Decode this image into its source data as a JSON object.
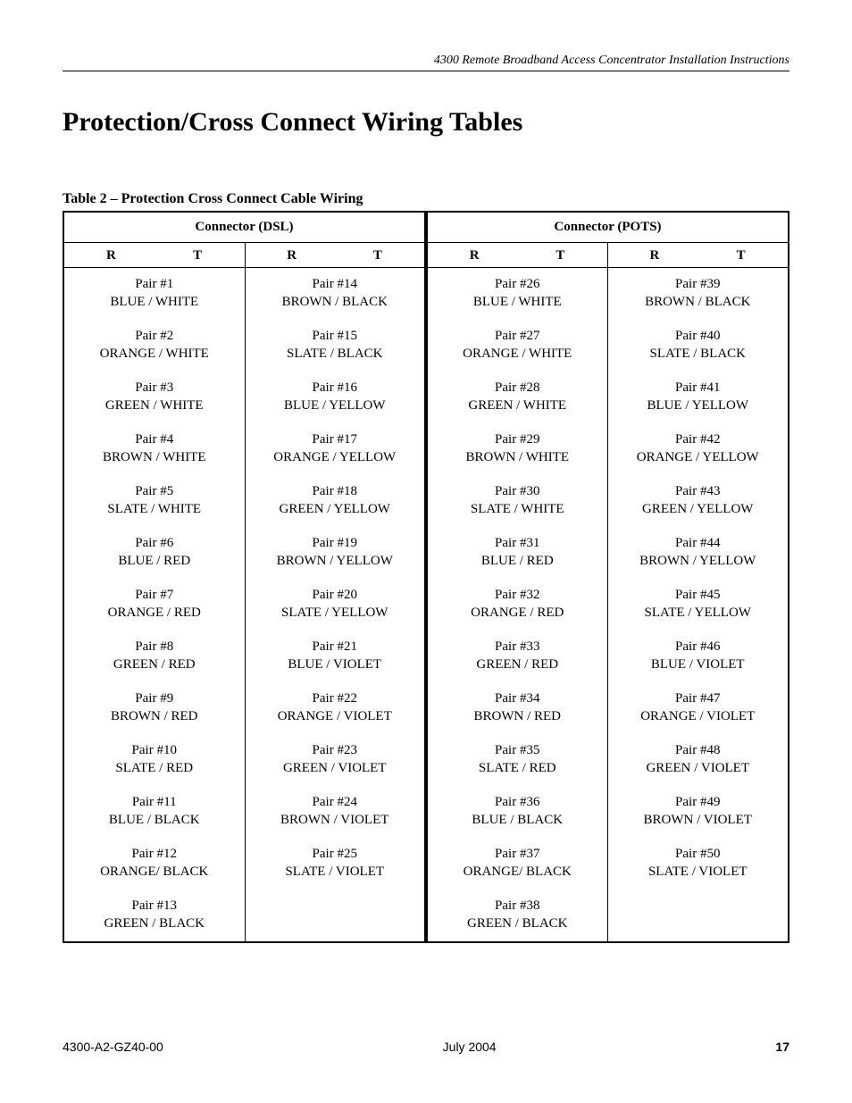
{
  "header": {
    "running": "4300 Remote Broadband Access Concentrator  Installation Instructions"
  },
  "title": "Protection/Cross Connect Wiring Tables",
  "caption": {
    "lead": "Table 2",
    "dash": "–",
    "rest": "Protection Cross Connect Cable Wiring"
  },
  "thead": {
    "dsl": "Connector (DSL)",
    "pots": "Connector (POTS)",
    "r": "R",
    "t": "T"
  },
  "rows": [
    {
      "c1p": "Pair #1",
      "c1c": "BLUE / WHITE",
      "c2p": "Pair #14",
      "c2c": "BROWN / BLACK",
      "c3p": "Pair #26",
      "c3c": "BLUE / WHITE",
      "c4p": "Pair #39",
      "c4c": "BROWN / BLACK"
    },
    {
      "c1p": "Pair #2",
      "c1c": "ORANGE / WHITE",
      "c2p": "Pair #15",
      "c2c": "SLATE / BLACK",
      "c3p": "Pair #27",
      "c3c": "ORANGE / WHITE",
      "c4p": "Pair #40",
      "c4c": "SLATE / BLACK"
    },
    {
      "c1p": "Pair #3",
      "c1c": "GREEN / WHITE",
      "c2p": "Pair #16",
      "c2c": "BLUE / YELLOW",
      "c3p": "Pair #28",
      "c3c": "GREEN / WHITE",
      "c4p": "Pair #41",
      "c4c": "BLUE / YELLOW"
    },
    {
      "c1p": "Pair #4",
      "c1c": "BROWN / WHITE",
      "c2p": "Pair #17",
      "c2c": "ORANGE / YELLOW",
      "c3p": "Pair #29",
      "c3c": "BROWN / WHITE",
      "c4p": "Pair #42",
      "c4c": "ORANGE / YELLOW"
    },
    {
      "c1p": "Pair #5",
      "c1c": "SLATE / WHITE",
      "c2p": "Pair #18",
      "c2c": "GREEN / YELLOW",
      "c3p": "Pair #30",
      "c3c": "SLATE / WHITE",
      "c4p": "Pair #43",
      "c4c": "GREEN / YELLOW"
    },
    {
      "c1p": "Pair #6",
      "c1c": "BLUE / RED",
      "c2p": "Pair #19",
      "c2c": "BROWN / YELLOW",
      "c3p": "Pair #31",
      "c3c": "BLUE / RED",
      "c4p": "Pair #44",
      "c4c": "BROWN / YELLOW"
    },
    {
      "c1p": "Pair #7",
      "c1c": "ORANGE / RED",
      "c2p": "Pair #20",
      "c2c": "SLATE / YELLOW",
      "c3p": "Pair #32",
      "c3c": "ORANGE / RED",
      "c4p": "Pair #45",
      "c4c": "SLATE / YELLOW"
    },
    {
      "c1p": "Pair #8",
      "c1c": "GREEN / RED",
      "c2p": "Pair #21",
      "c2c": "BLUE / VIOLET",
      "c3p": "Pair #33",
      "c3c": "GREEN / RED",
      "c4p": "Pair #46",
      "c4c": "BLUE / VIOLET"
    },
    {
      "c1p": "Pair #9",
      "c1c": "BROWN / RED",
      "c2p": "Pair #22",
      "c2c": "ORANGE / VIOLET",
      "c3p": "Pair #34",
      "c3c": "BROWN / RED",
      "c4p": "Pair #47",
      "c4c": "ORANGE / VIOLET"
    },
    {
      "c1p": "Pair #10",
      "c1c": "SLATE / RED",
      "c2p": "Pair #23",
      "c2c": "GREEN / VIOLET",
      "c3p": "Pair #35",
      "c3c": "SLATE / RED",
      "c4p": "Pair #48",
      "c4c": "GREEN / VIOLET"
    },
    {
      "c1p": "Pair #11",
      "c1c": "BLUE / BLACK",
      "c2p": "Pair #24",
      "c2c": "BROWN / VIOLET",
      "c3p": "Pair #36",
      "c3c": "BLUE / BLACK",
      "c4p": "Pair #49",
      "c4c": "BROWN / VIOLET"
    },
    {
      "c1p": "Pair #12",
      "c1c": "ORANGE/ BLACK",
      "c2p": "Pair #25",
      "c2c": "SLATE / VIOLET",
      "c3p": "Pair #37",
      "c3c": "ORANGE/ BLACK",
      "c4p": "Pair #50",
      "c4c": "SLATE / VIOLET"
    },
    {
      "c1p": "Pair #13",
      "c1c": "GREEN / BLACK",
      "c2p": "",
      "c2c": "",
      "c3p": "Pair #38",
      "c3c": "GREEN / BLACK",
      "c4p": "",
      "c4c": ""
    }
  ],
  "footer": {
    "left": "4300-A2-GZ40-00",
    "center": "July 2004",
    "right": "17"
  }
}
